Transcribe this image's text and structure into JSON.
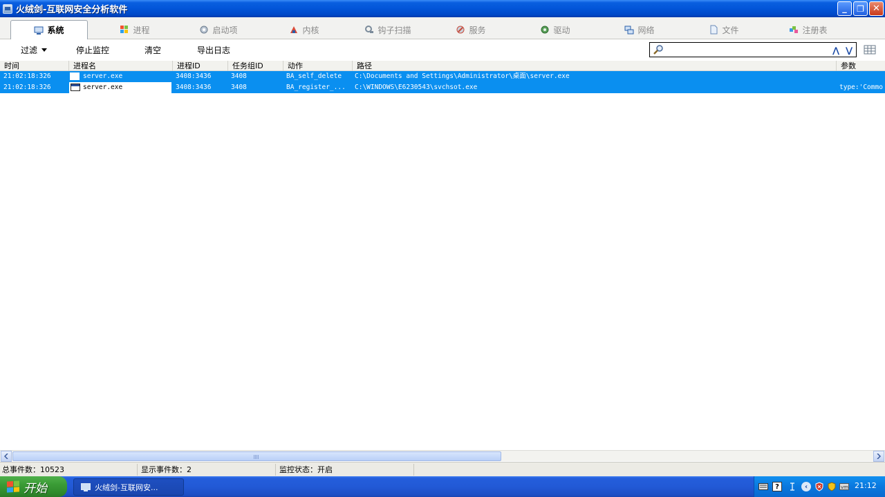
{
  "window": {
    "title": "火绒剑-互联网安全分析软件",
    "buttons": {
      "minimize": "_",
      "restore": "❐",
      "close": "✕"
    }
  },
  "tabs": [
    {
      "label": "系统",
      "icon": "system-monitor-icon",
      "active": true
    },
    {
      "label": "进程",
      "icon": "windows-flag-icon",
      "active": false
    },
    {
      "label": "启动项",
      "icon": "gear-icon",
      "active": false
    },
    {
      "label": "内核",
      "icon": "kernel-icon",
      "active": false
    },
    {
      "label": "钩子扫描",
      "icon": "hook-scan-icon",
      "active": false
    },
    {
      "label": "服务",
      "icon": "service-icon",
      "active": false
    },
    {
      "label": "驱动",
      "icon": "driver-icon",
      "active": false
    },
    {
      "label": "网络",
      "icon": "network-icon",
      "active": false
    },
    {
      "label": "文件",
      "icon": "file-icon",
      "active": false
    },
    {
      "label": "注册表",
      "icon": "registry-icon",
      "active": false
    }
  ],
  "toolbar": {
    "filter": "过滤",
    "stop_monitor": "停止监控",
    "clear": "清空",
    "export_log": "导出日志",
    "search_placeholder": "",
    "prev_arrow": "⋀",
    "next_arrow": "⋁"
  },
  "table": {
    "columns": [
      "时间",
      "进程名",
      "进程ID",
      "任务组ID",
      "动作",
      "路径",
      "参数"
    ],
    "rows": [
      {
        "time": "21:02:18:326",
        "process": "server.exe",
        "pid": "3408:3436",
        "group": "3408",
        "action": "BA_self_delete",
        "path": "C:\\Documents and Settings\\Administrator\\桌面\\server.exe",
        "param": ""
      },
      {
        "time": "21:02:18:326",
        "process": "server.exe",
        "pid": "3408:3436",
        "group": "3408",
        "action": "BA_register_...",
        "path": "C:\\WINDOWS\\E6230543\\svchsot.exe",
        "param": "type:'Commo"
      }
    ]
  },
  "status": {
    "total": "总事件数：10523",
    "shown": "显示事件数：2",
    "monitor": "监控状态：开启"
  },
  "taskbar": {
    "start": "开始",
    "item": "火绒剑-互联网安...",
    "clock": "21:12"
  },
  "colors": {
    "selection": "#0a8ff0",
    "titlebar": "#0255d8",
    "taskbar": "#245edb",
    "start_button": "#3a9b35"
  }
}
